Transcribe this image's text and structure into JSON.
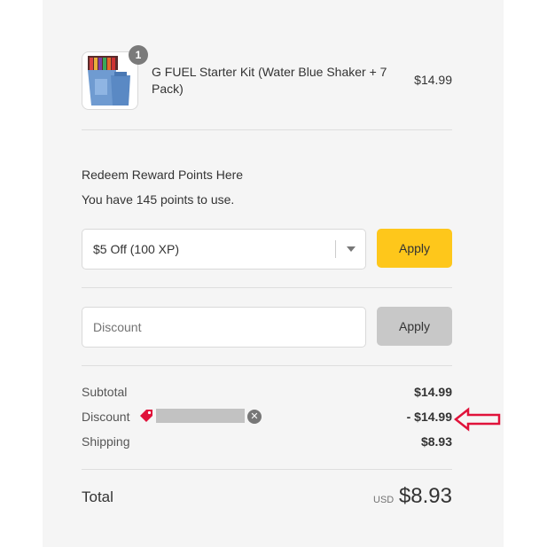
{
  "product": {
    "image": "shaker-kit-thumbnail",
    "quantity": "1",
    "name": "G FUEL Starter Kit (Water Blue Shaker + 7 Pack)",
    "price": "$14.99"
  },
  "rewards": {
    "title": "Redeem Reward Points Here",
    "points_text": "You have 145 points to use.",
    "selected_option": "$5 Off (100 XP)",
    "apply_label": "Apply",
    "icon": "chevron-down-icon"
  },
  "discount": {
    "placeholder": "Discount",
    "apply_label": "Apply"
  },
  "summary": {
    "subtotal_label": "Subtotal",
    "subtotal_value": "$14.99",
    "discount_label": "Discount",
    "discount_value": "- $14.99",
    "shipping_label": "Shipping",
    "shipping_value": "$8.93",
    "total_label": "Total",
    "currency": "USD",
    "total_value": "$8.93"
  },
  "colors": {
    "apply_points_bg": "#fec71b",
    "apply_discount_bg": "#c8c8c8",
    "tag_icon": "#e0123a",
    "annotation_arrow": "#e0123a"
  }
}
